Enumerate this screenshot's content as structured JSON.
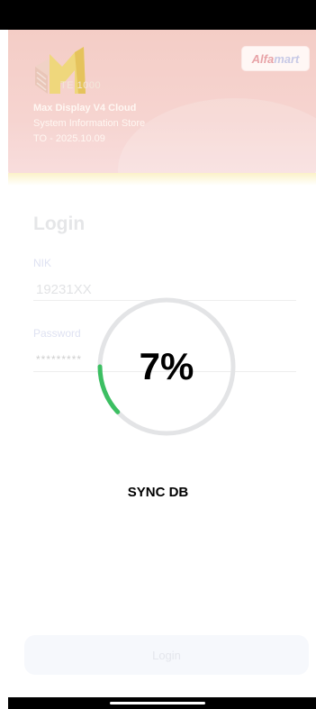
{
  "header": {
    "app_number": "TE 1000",
    "brand_part1": "Alfa",
    "brand_part2": "mart",
    "app_name": "Max Display V4 Cloud",
    "subtitle": "System Information Store",
    "version": "TO - 2025.10.09"
  },
  "login": {
    "title": "Login",
    "nik_label": "NIK",
    "nik_value": "19231XX",
    "password_label": "Password",
    "password_value": "*********",
    "button_label": "Login"
  },
  "sync": {
    "progress_percent": 7,
    "progress_text": "7%",
    "label": "SYNC DB",
    "track_color": "#e3e4e6",
    "fill_color": "#3cbf62"
  }
}
